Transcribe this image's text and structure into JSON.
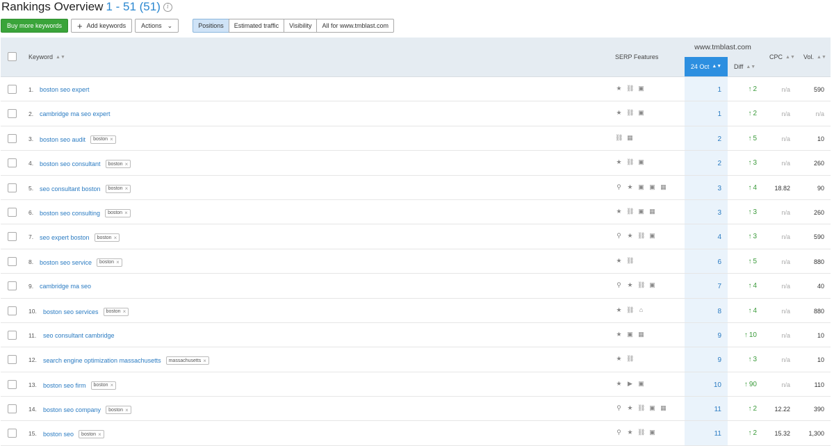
{
  "header": {
    "title": "Rankings Overview",
    "range": "1 - 51 (51)",
    "info_icon": "i"
  },
  "toolbar": {
    "buy_label": "Buy more keywords",
    "add_label": "Add keywords",
    "add_icon": "+",
    "actions_label": "Actions",
    "actions_chevron": "⌄",
    "segments": [
      "Positions",
      "Estimated traffic",
      "Visibility",
      "All for www.tmblast.com"
    ],
    "active_segment": "Positions"
  },
  "table": {
    "columns": {
      "keyword": "Keyword",
      "serp": "SERP Features",
      "site": "www.tmblast.com",
      "date": "24 Oct",
      "diff": "Diff",
      "cpc": "CPC",
      "vol": "Vol."
    },
    "sort_glyph": "▲▼",
    "rows": [
      {
        "num": "1.",
        "kw": "boston seo expert",
        "tag": "",
        "feats": [
          "star",
          "link",
          "image"
        ],
        "pos": "1",
        "diff": "2",
        "cpc": "n/a",
        "vol": "590"
      },
      {
        "num": "2.",
        "kw": "cambridge ma seo expert",
        "tag": "",
        "feats": [
          "star",
          "link",
          "image"
        ],
        "pos": "1",
        "diff": "2",
        "cpc": "n/a",
        "vol": "n/a"
      },
      {
        "num": "3.",
        "kw": "boston seo audit",
        "tag": "boston",
        "feats": [
          "link",
          "shop"
        ],
        "pos": "2",
        "diff": "5",
        "cpc": "n/a",
        "vol": "10"
      },
      {
        "num": "4.",
        "kw": "boston seo consultant",
        "tag": "boston",
        "feats": [
          "star",
          "link",
          "image"
        ],
        "pos": "2",
        "diff": "3",
        "cpc": "n/a",
        "vol": "260"
      },
      {
        "num": "5.",
        "kw": "seo consultant boston",
        "tag": "boston",
        "feats": [
          "pin",
          "star",
          "image",
          "image",
          "shop"
        ],
        "pos": "3",
        "diff": "4",
        "cpc": "18.82",
        "vol": "90"
      },
      {
        "num": "6.",
        "kw": "boston seo consulting",
        "tag": "boston",
        "feats": [
          "star",
          "link",
          "image",
          "shop"
        ],
        "pos": "3",
        "diff": "3",
        "cpc": "n/a",
        "vol": "260"
      },
      {
        "num": "7.",
        "kw": "seo expert boston",
        "tag": "boston",
        "feats": [
          "pin",
          "star",
          "link",
          "image"
        ],
        "pos": "4",
        "diff": "3",
        "cpc": "n/a",
        "vol": "590"
      },
      {
        "num": "8.",
        "kw": "boston seo service",
        "tag": "boston",
        "feats": [
          "star",
          "link"
        ],
        "pos": "6",
        "diff": "5",
        "cpc": "n/a",
        "vol": "880"
      },
      {
        "num": "9.",
        "kw": "cambridge ma seo",
        "tag": "",
        "feats": [
          "pin",
          "star",
          "link",
          "image"
        ],
        "pos": "7",
        "diff": "4",
        "cpc": "n/a",
        "vol": "40"
      },
      {
        "num": "10.",
        "kw": "boston seo services",
        "tag": "boston",
        "feats": [
          "star",
          "link",
          "grad"
        ],
        "pos": "8",
        "diff": "4",
        "cpc": "n/a",
        "vol": "880"
      },
      {
        "num": "11.",
        "kw": "seo consultant cambridge",
        "tag": "",
        "feats": [
          "star",
          "image",
          "shop"
        ],
        "pos": "9",
        "diff": "10",
        "cpc": "n/a",
        "vol": "10"
      },
      {
        "num": "12.",
        "kw": "search engine optimization massachusetts",
        "tag": "massachusetts",
        "feats": [
          "star",
          "link"
        ],
        "pos": "9",
        "diff": "3",
        "cpc": "n/a",
        "vol": "10"
      },
      {
        "num": "13.",
        "kw": "boston seo firm",
        "tag": "boston",
        "feats": [
          "star",
          "video",
          "image"
        ],
        "pos": "10",
        "diff": "90",
        "cpc": "n/a",
        "vol": "110"
      },
      {
        "num": "14.",
        "kw": "boston seo company",
        "tag": "boston",
        "feats": [
          "pin",
          "star",
          "link",
          "image",
          "shop"
        ],
        "pos": "11",
        "diff": "2",
        "cpc": "12.22",
        "vol": "390"
      },
      {
        "num": "15.",
        "kw": "boston seo",
        "tag": "boston",
        "feats": [
          "pin",
          "star",
          "link",
          "image"
        ],
        "pos": "11",
        "diff": "2",
        "cpc": "15.32",
        "vol": "1,300"
      }
    ]
  },
  "icons": {
    "star": "★",
    "link": "⛓",
    "image": "▣",
    "shop": "▦",
    "pin": "⚲",
    "video": "▶",
    "grad": "⌂",
    "up_arrow": "↑",
    "tag_close": "×"
  },
  "colors": {
    "accent": "#2d8fe0",
    "link": "#2a7bc2",
    "positive": "#3a9a3a",
    "buy_button": "#3aa43a",
    "header_bg": "#e5ecf2"
  }
}
